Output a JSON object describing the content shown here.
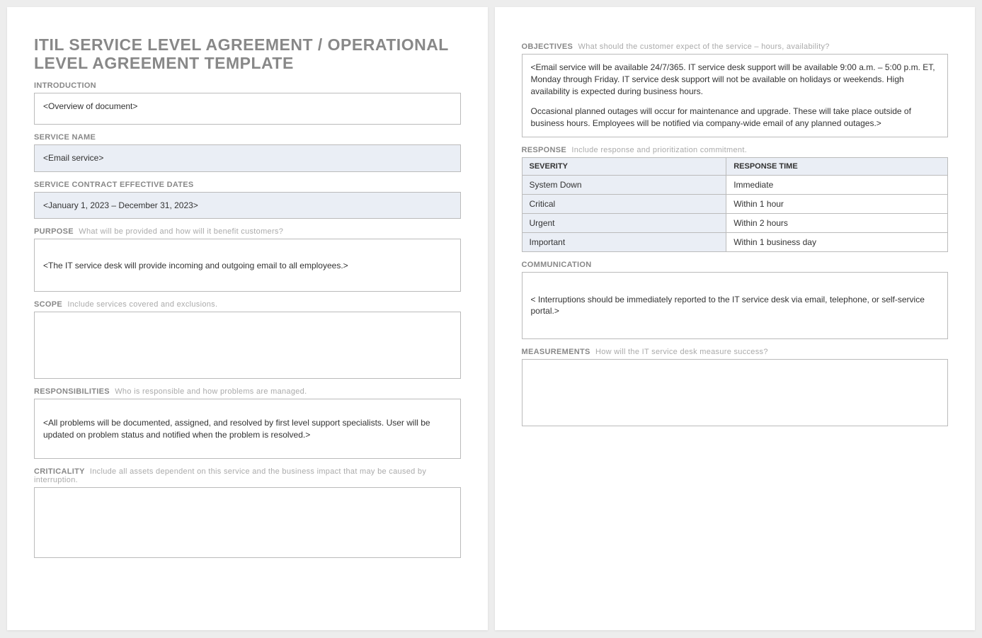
{
  "title": "ITIL SERVICE LEVEL AGREEMENT / OPERATIONAL LEVEL AGREEMENT TEMPLATE",
  "sections": {
    "introduction": {
      "label": "INTRODUCTION",
      "content": "<Overview of document>"
    },
    "service_name": {
      "label": "SERVICE NAME",
      "content": "<Email service>"
    },
    "dates": {
      "label": "SERVICE CONTRACT EFFECTIVE DATES",
      "content": "<January 1, 2023 – December 31, 2023>"
    },
    "purpose": {
      "label": "PURPOSE",
      "hint": "What will be provided and how will it benefit customers?",
      "content": "<The IT service desk will provide incoming and outgoing email to all employees.>"
    },
    "scope": {
      "label": "SCOPE",
      "hint": "Include services covered and exclusions.",
      "content": ""
    },
    "responsibilities": {
      "label": "RESPONSIBILITIES",
      "hint": "Who is responsible and how problems are managed.",
      "content": "<All problems will be documented, assigned, and resolved by first level support specialists. User will be updated on problem status and notified when the problem is resolved.>"
    },
    "criticality": {
      "label": "CRITICALITY",
      "hint": "Include all assets dependent on this service and the business impact that may be caused by interruption.",
      "content": ""
    },
    "objectives": {
      "label": "OBJECTIVES",
      "hint": "What should the customer expect of the service – hours, availability?",
      "p1": "<Email service will be available 24/7/365. IT service desk support will be available 9:00 a.m. – 5:00 p.m. ET, Monday through Friday. IT service desk support will not be available on holidays or weekends. High availability is expected during business hours.",
      "p2": "Occasional planned outages will occur for maintenance and upgrade. These will take place outside of business hours. Employees will be notified via company-wide email of any planned outages.>"
    },
    "response": {
      "label": "RESPONSE",
      "hint": "Include response and prioritization commitment.",
      "headers": {
        "severity": "SEVERITY",
        "time": "RESPONSE TIME"
      },
      "rows": [
        {
          "severity": "System Down",
          "time": "Immediate"
        },
        {
          "severity": "Critical",
          "time": "Within 1 hour"
        },
        {
          "severity": "Urgent",
          "time": "Within 2 hours"
        },
        {
          "severity": "Important",
          "time": "Within 1 business day"
        }
      ]
    },
    "communication": {
      "label": "COMMUNICATION",
      "content": "< Interruptions should be immediately reported to the IT service desk via email, telephone, or self-service portal.>"
    },
    "measurements": {
      "label": "MEASUREMENTS",
      "hint": "How will the IT service desk measure success?",
      "content": ""
    }
  }
}
